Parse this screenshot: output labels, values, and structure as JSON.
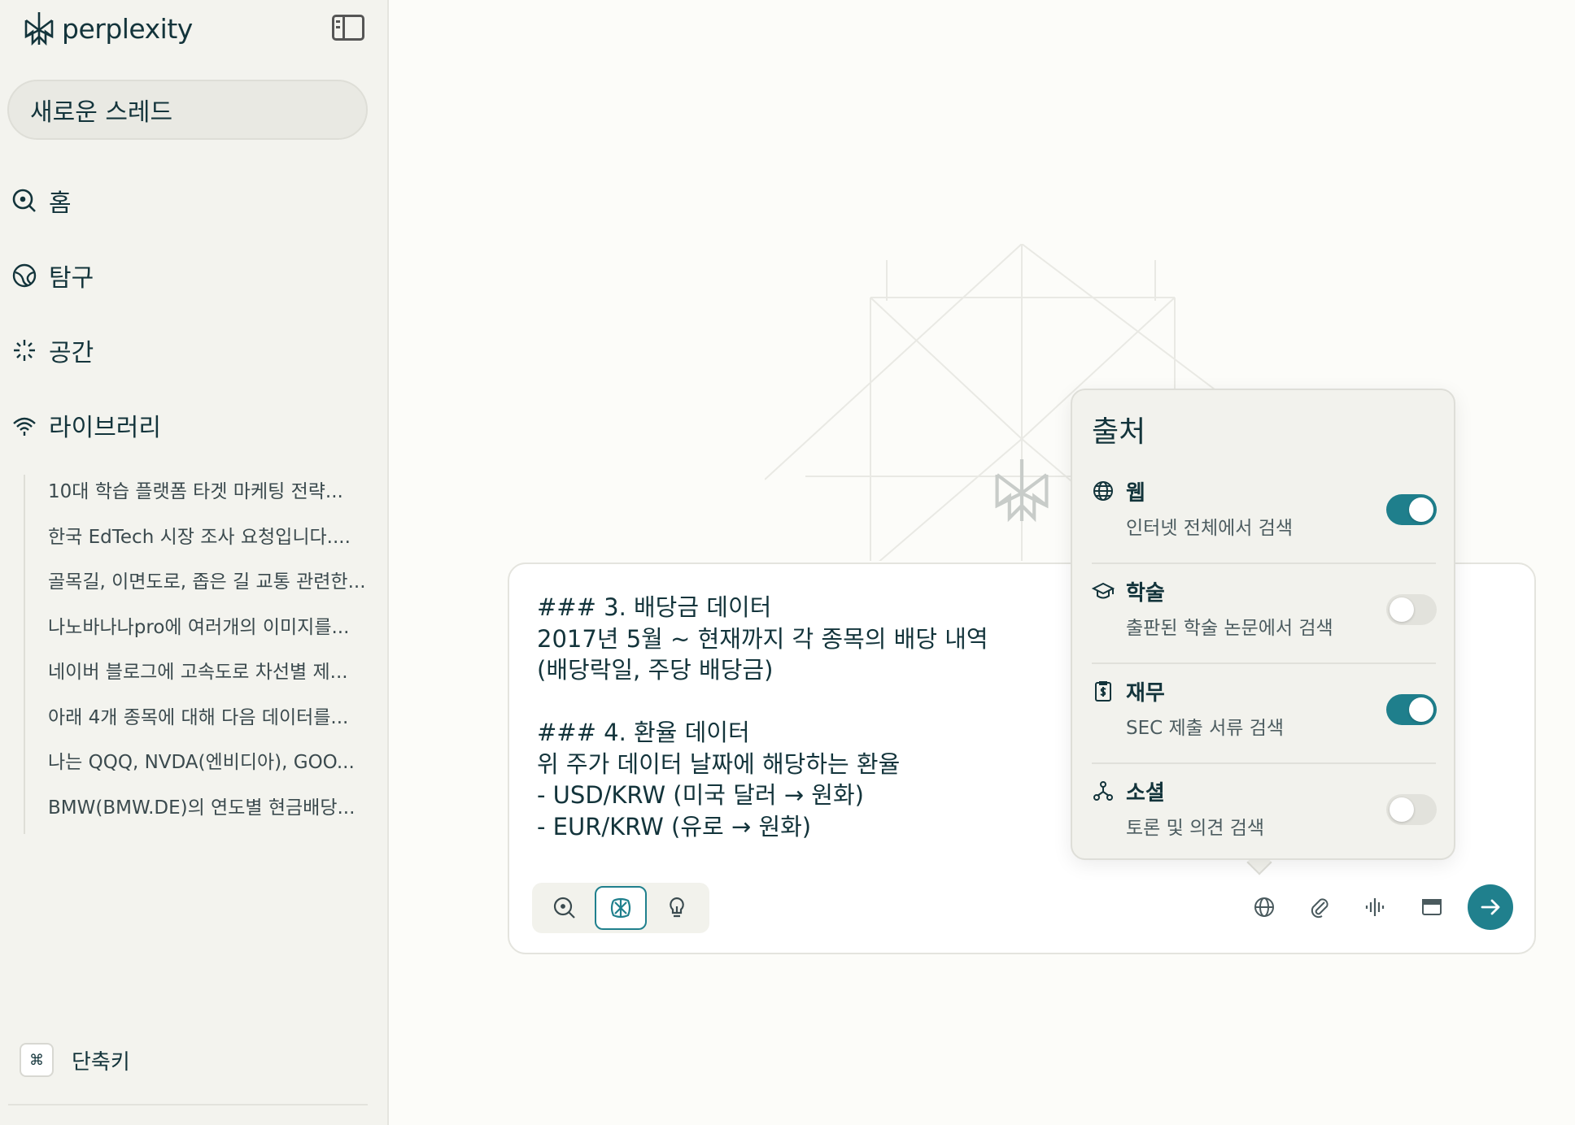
{
  "app": {
    "name": "perplexity"
  },
  "sidebar": {
    "new_thread_label": "새로운 스레드",
    "nav": [
      {
        "label": "홈",
        "icon": "search-icon"
      },
      {
        "label": "탐구",
        "icon": "globe-icon"
      },
      {
        "label": "공간",
        "icon": "spaces-icon"
      },
      {
        "label": "라이브러리",
        "icon": "library-icon"
      }
    ],
    "history": [
      "10대 학습 플랫폼 타겟 마케팅 전략...",
      "한국 EdTech 시장 조사 요청입니다....",
      "골목길, 이면도로, 좁은 길 교통 관련한...",
      "나노바나나pro에 여러개의 이미지를...",
      "네이버 블로그에 고속도로 차선별 제...",
      "아래 4개 종목에 대해 다음 데이터를...",
      "나는 QQQ, NVDA(엔비디아), GOO...",
      "BMW(BMW.DE)의 연도별 현금배당..."
    ],
    "shortcut_key": "⌘",
    "shortcut_label": "단축키"
  },
  "composer": {
    "text": "### 3. 배당금 데이터\n2017년 5월 ~ 현재까지 각 종목의 배당 내역\n(배당락일, 주당 배당금)\n\n### 4. 환율 데이터\n위 주가 데이터 날짜에 해당하는 환율\n- USD/KRW (미국 달러 → 원화)\n- EUR/KRW (유로 → 원화)",
    "modes": [
      {
        "name": "search",
        "icon": "search-icon",
        "active": false
      },
      {
        "name": "research",
        "icon": "research-icon",
        "active": true
      },
      {
        "name": "labs",
        "icon": "lightbulb-icon",
        "active": false
      }
    ],
    "tools": [
      "globe-icon",
      "paperclip-icon",
      "voice-icon",
      "browser-icon"
    ],
    "send_icon": "arrow-right-icon"
  },
  "sources_popover": {
    "title": "출처",
    "items": [
      {
        "name": "웹",
        "description": "인터넷 전체에서 검색",
        "icon": "globe-icon",
        "enabled": true
      },
      {
        "name": "학술",
        "description": "출판된 학술 논문에서 검색",
        "icon": "graduation-cap-icon",
        "enabled": false
      },
      {
        "name": "재무",
        "description": "SEC 제출 서류 검색",
        "icon": "finance-doc-icon",
        "enabled": true
      },
      {
        "name": "소셜",
        "description": "토론 및 의견 검색",
        "icon": "social-network-icon",
        "enabled": false
      }
    ]
  },
  "colors": {
    "accent": "#20808d",
    "background": "#fcfcf9",
    "sidebar": "#f3f3ee",
    "text": "#13343b"
  }
}
